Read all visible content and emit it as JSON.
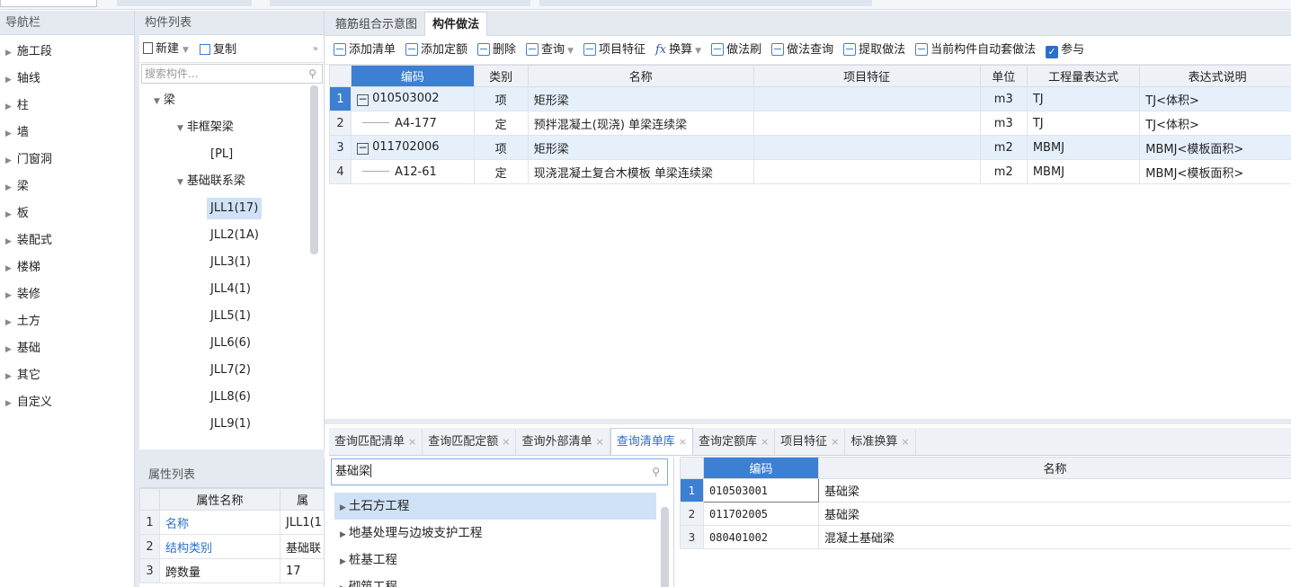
{
  "nav": {
    "title": "导航栏",
    "items": [
      "施工段",
      "轴线",
      "柱",
      "墙",
      "门窗洞",
      "梁",
      "板",
      "装配式",
      "楼梯",
      "装修",
      "土方",
      "基础",
      "其它",
      "自定义"
    ]
  },
  "components": {
    "title": "构件列表",
    "new_label": "新建",
    "copy_label": "复制",
    "search_placeholder": "搜索构件...",
    "tree": {
      "root": "梁",
      "group1": "非框架梁",
      "group1_children": [
        "[PL]"
      ],
      "group2": "基础联系梁",
      "group2_children": [
        "JLL1(17)",
        "JLL2(1A)",
        "JLL3(1)",
        "JLL4(1)",
        "JLL5(1)",
        "JLL6(6)",
        "JLL7(2)",
        "JLL8(6)",
        "JLL9(1)"
      ]
    }
  },
  "properties": {
    "title": "属性列表",
    "headers": [
      "属性名称",
      "属"
    ],
    "rows": [
      {
        "num": "1",
        "name": "名称",
        "value": "JLL1(1"
      },
      {
        "num": "2",
        "name": "结构类别",
        "value": "基础联"
      },
      {
        "num": "3",
        "name": "跨数量",
        "value": "17"
      }
    ]
  },
  "main": {
    "tabs": [
      "箍筋组合示意图",
      "构件做法"
    ],
    "toolbar": [
      "添加清单",
      "添加定额",
      "删除",
      "查询",
      "项目特征",
      "换算",
      "做法刷",
      "做法查询",
      "提取做法",
      "当前构件自动套做法",
      "参与"
    ],
    "headers": [
      "编码",
      "类别",
      "名称",
      "项目特征",
      "单位",
      "工程量表达式",
      "表达式说明"
    ],
    "rows": [
      {
        "num": "1",
        "code": "010503002",
        "type": "项",
        "name": "矩形梁",
        "feature": "",
        "unit": "m3",
        "expr": "TJ",
        "desc": "TJ<体积>"
      },
      {
        "num": "2",
        "code": "A4-177",
        "type": "定",
        "name": "预拌混凝土(现浇) 单梁连续梁",
        "feature": "",
        "unit": "m3",
        "expr": "TJ",
        "desc": "TJ<体积>"
      },
      {
        "num": "3",
        "code": "011702006",
        "type": "项",
        "name": "矩形梁",
        "feature": "",
        "unit": "m2",
        "expr": "MBMJ",
        "desc": "MBMJ<模板面积>"
      },
      {
        "num": "4",
        "code": "A12-61",
        "type": "定",
        "name": "现浇混凝土复合木模板 单梁连续梁",
        "feature": "",
        "unit": "m2",
        "expr": "MBMJ",
        "desc": "MBMJ<模板面积>"
      }
    ]
  },
  "bottom": {
    "tabs": [
      "查询匹配清单",
      "查询匹配定额",
      "查询外部清单",
      "查询清单库",
      "查询定额库",
      "项目特征",
      "标准换算"
    ],
    "search_value": "基础梁",
    "lib_items": [
      "土石方工程",
      "地基处理与边坡支护工程",
      "桩基工程",
      "砌筑工程"
    ],
    "results_headers": [
      "编码",
      "名称"
    ],
    "results": [
      {
        "num": "1",
        "code": "010503001",
        "name": "基础梁"
      },
      {
        "num": "2",
        "code": "011702005",
        "name": "基础梁"
      },
      {
        "num": "3",
        "code": "080401002",
        "name": "混凝土基础梁"
      }
    ]
  }
}
